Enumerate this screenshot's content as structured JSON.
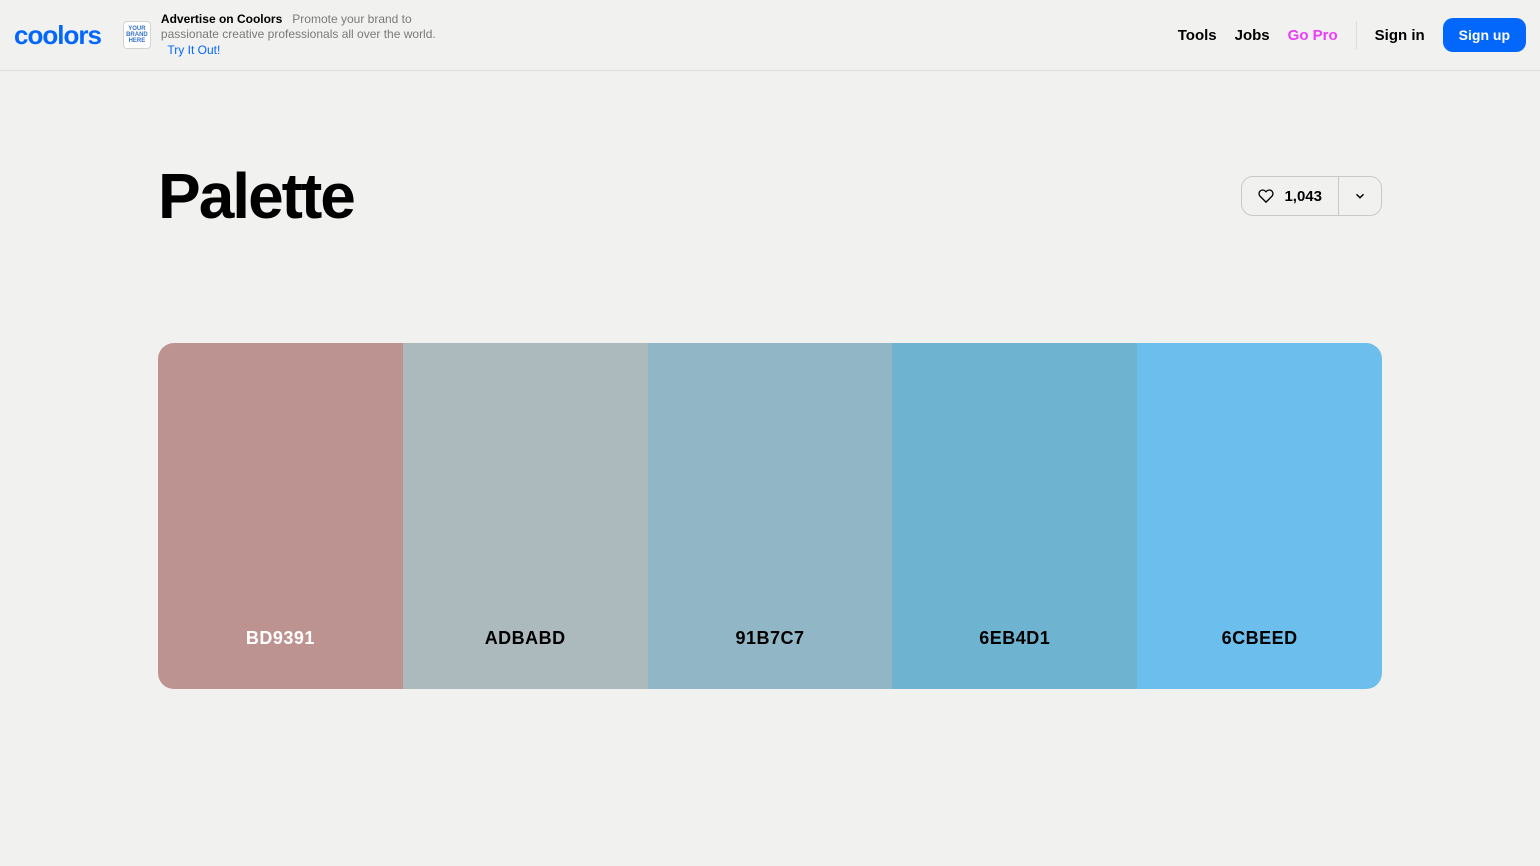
{
  "header": {
    "logo_text": "coolors",
    "ad": {
      "icon_text": "YOUR BRAND HERE",
      "title": "Advertise on Coolors",
      "description": "Promote your brand to passionate creative professionals all over the world.",
      "link_label": "Try It Out!"
    },
    "nav": {
      "tools": "Tools",
      "jobs": "Jobs",
      "go_pro": "Go Pro",
      "sign_in": "Sign in",
      "sign_up": "Sign up"
    }
  },
  "page": {
    "title": "Palette",
    "like_count": "1,043"
  },
  "palette": [
    {
      "hex": "BD9391",
      "bg": "#BD9391",
      "text_color": "#ffffff"
    },
    {
      "hex": "ADBABD",
      "bg": "#ADBABD",
      "text_color": "#000000"
    },
    {
      "hex": "91B7C7",
      "bg": "#91B7C7",
      "text_color": "#000000"
    },
    {
      "hex": "6EB4D1",
      "bg": "#6EB4D1",
      "text_color": "#000000"
    },
    {
      "hex": "6CBEED",
      "bg": "#6CBEED",
      "text_color": "#000000"
    }
  ]
}
